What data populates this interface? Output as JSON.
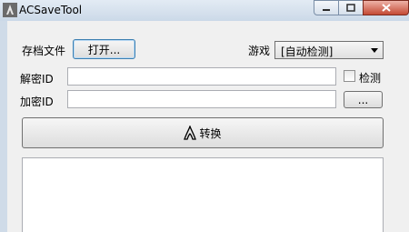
{
  "window": {
    "title": "ACSaveTool"
  },
  "form": {
    "save_file_label": "存档文件",
    "open_button": "打开...",
    "game_label": "游戏",
    "game_select_value": "[自动检测]",
    "decrypt_id_label": "解密ID",
    "decrypt_id_value": "",
    "detect_label": "检测",
    "detect_checked": false,
    "encrypt_id_label": "加密ID",
    "encrypt_id_value": "",
    "browse_button": "...",
    "convert_button": "转换"
  },
  "log": {
    "text": ""
  },
  "icons": {
    "app": "assassin-creed-logo-icon",
    "convert": "assassin-creed-logo-icon"
  }
}
